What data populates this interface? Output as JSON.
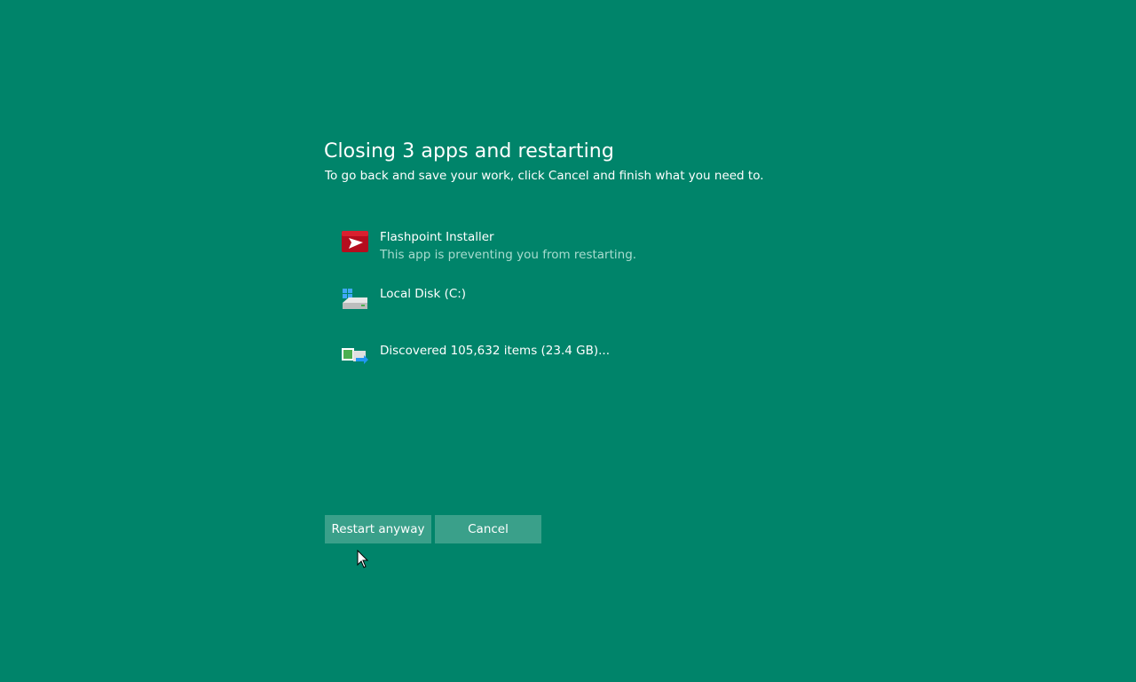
{
  "dialog": {
    "title": "Closing 3 apps and restarting",
    "subtitle": "To go back and save your work, click Cancel and finish what you need to."
  },
  "apps": [
    {
      "name": "Flashpoint Installer",
      "status": "This app is preventing you from restarting.",
      "icon": "flashpoint-icon"
    },
    {
      "name": "Local Disk (C:)",
      "status": "",
      "icon": "local-disk-icon"
    },
    {
      "name": "Discovered 105,632 items (23.4 GB)...",
      "status": "",
      "icon": "file-transfer-icon"
    }
  ],
  "buttons": {
    "restart_label": "Restart anyway",
    "cancel_label": "Cancel"
  },
  "colors": {
    "background": "#00846a",
    "button": "#3aa08a",
    "secondary_text": "#a8dccf"
  }
}
